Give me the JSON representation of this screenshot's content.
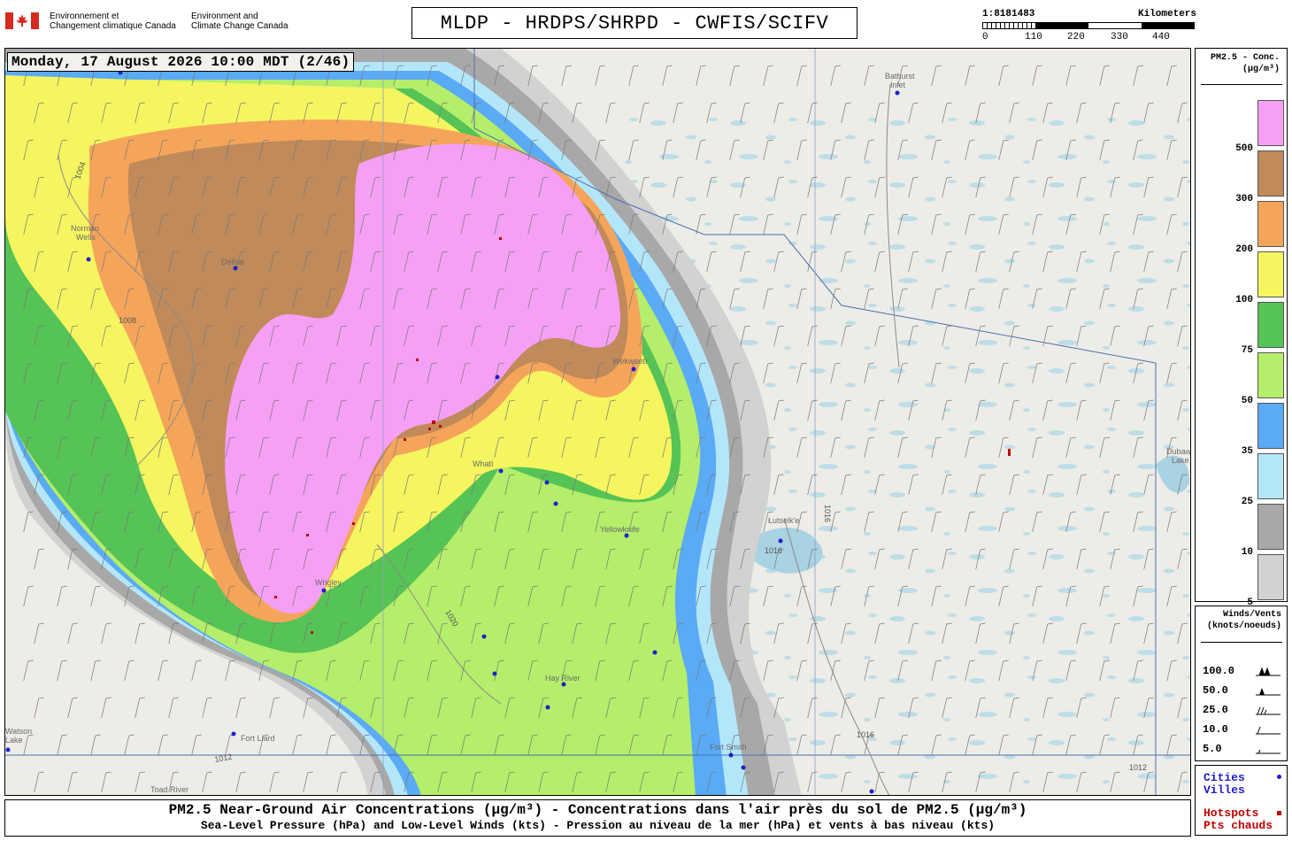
{
  "header": {
    "dept_fr": [
      "Environnement et",
      "Changement climatique Canada"
    ],
    "dept_en": [
      "Environment and",
      "Climate Change Canada"
    ],
    "title": "MLDP - HRDPS/SHRPD - CWFIS/SCIFV",
    "scale": {
      "ratio": "1:8181483",
      "unit": "Kilometers",
      "ticks": [
        "0",
        "110",
        "220",
        "330",
        "440"
      ]
    }
  },
  "map": {
    "timestamp": "Monday, 17 August 2026 10:00 MDT (2/46)",
    "places": [
      {
        "name": "Bathurst",
        "name2": "Inlet"
      },
      {
        "name": "Délīne"
      },
      {
        "name": "Norman",
        "name2": "Wells"
      },
      {
        "name": "Wekweètì"
      },
      {
        "name": "Whatì"
      },
      {
        "name": "Yellowknife"
      },
      {
        "name": "Łutselk'e"
      },
      {
        "name": "Dubawnt",
        "name2": "Lake"
      },
      {
        "name": "Wrigley"
      },
      {
        "name": "Hay River"
      },
      {
        "name": "Fort Liard"
      },
      {
        "name": "Fort Smith"
      },
      {
        "name": "Toad River"
      },
      {
        "name": "Watson",
        "name2": "Lake"
      }
    ],
    "isobars": [
      "1004",
      "1008",
      "1012",
      "1016",
      "1020"
    ]
  },
  "legend_conc": {
    "title_line1": "PM2.5 - Conc.",
    "title_line2": "(μg/m³)",
    "levels": [
      {
        "value": "500",
        "color": "#f5a0f5"
      },
      {
        "value": "300",
        "color": "#c08a5a"
      },
      {
        "value": "200",
        "color": "#f5a55a"
      },
      {
        "value": "100",
        "color": "#f5f560"
      },
      {
        "value": "75",
        "color": "#55c355"
      },
      {
        "value": "50",
        "color": "#b4ee6a"
      },
      {
        "value": "35",
        "color": "#5aaaf5"
      },
      {
        "value": "25",
        "color": "#b4e6fa"
      },
      {
        "value": "10",
        "color": "#a8a8a8"
      },
      {
        "value": "5",
        "color": "#d2d2d2"
      }
    ]
  },
  "legend_wind": {
    "title_line1": "Winds/Vents",
    "title_line2": "(knots/noeuds)",
    "speeds": [
      "100.0",
      "50.0",
      "25.0",
      "10.0",
      "5.0"
    ]
  },
  "legend_markers": {
    "cities_en": "Cities",
    "cities_fr": "Villes",
    "hotspots_en": "Hotspots",
    "hotspots_fr": "Pts chauds",
    "city_color": "#1f1fcc",
    "hotspot_color": "#c00000"
  },
  "caption": {
    "line1": "PM2.5 Near-Ground Air Concentrations (μg/m³) - Concentrations dans l'air près du sol de PM2.5 (μg/m³)",
    "line2": "Sea-Level Pressure (hPa) and Low-Level Winds (kts) - Pression au niveau de la mer (hPa) et vents à bas niveau (kts)"
  }
}
